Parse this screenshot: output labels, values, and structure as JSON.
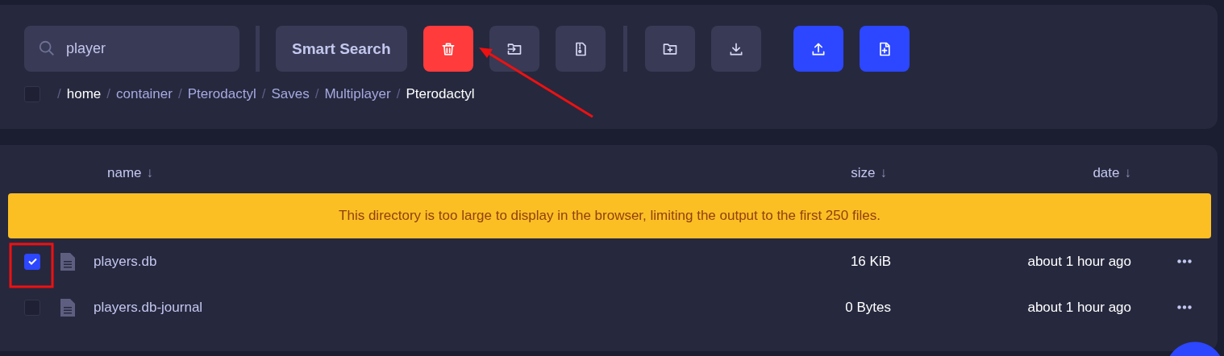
{
  "toolbar": {
    "search": {
      "value": "player"
    },
    "buttons": [
      {
        "kind": "text",
        "label": "Smart Search"
      },
      {
        "kind": "icon"
      },
      {
        "kind": "icon"
      },
      {
        "kind": "icon"
      },
      {
        "kind": "divider"
      },
      {
        "kind": "icon"
      },
      {
        "kind": "icon"
      },
      {
        "kind": "spacer"
      },
      {
        "kind": "icon"
      },
      {
        "kind": "icon"
      }
    ]
  },
  "breadcrumb": {
    "select_all": {
      "checked": false
    },
    "separator": "/",
    "segments": [
      {
        "label": "home",
        "emphasized": true
      },
      {
        "label": "container",
        "emphasized": false
      },
      {
        "label": "Pterodactyl",
        "emphasized": false
      },
      {
        "label": "Saves",
        "emphasized": false
      },
      {
        "label": "Multiplayer",
        "emphasized": false
      },
      {
        "label": "Pterodactyl",
        "emphasized": true
      }
    ]
  },
  "table": {
    "columns": [
      {
        "label": "name",
        "sort": "↓"
      },
      {
        "label": "size",
        "sort": "↓"
      },
      {
        "label": "date",
        "sort": "↓"
      }
    ],
    "notice": "This directory is too large to display in the browser, limiting the output to the first 250 files.",
    "rows": [
      {
        "checked": true,
        "name": "players.db",
        "size": "16 KiB",
        "date": "about 1 hour ago"
      },
      {
        "checked": false,
        "name": "players.db-journal",
        "size": "0 Bytes",
        "date": "about 1 hour ago"
      }
    ]
  }
}
